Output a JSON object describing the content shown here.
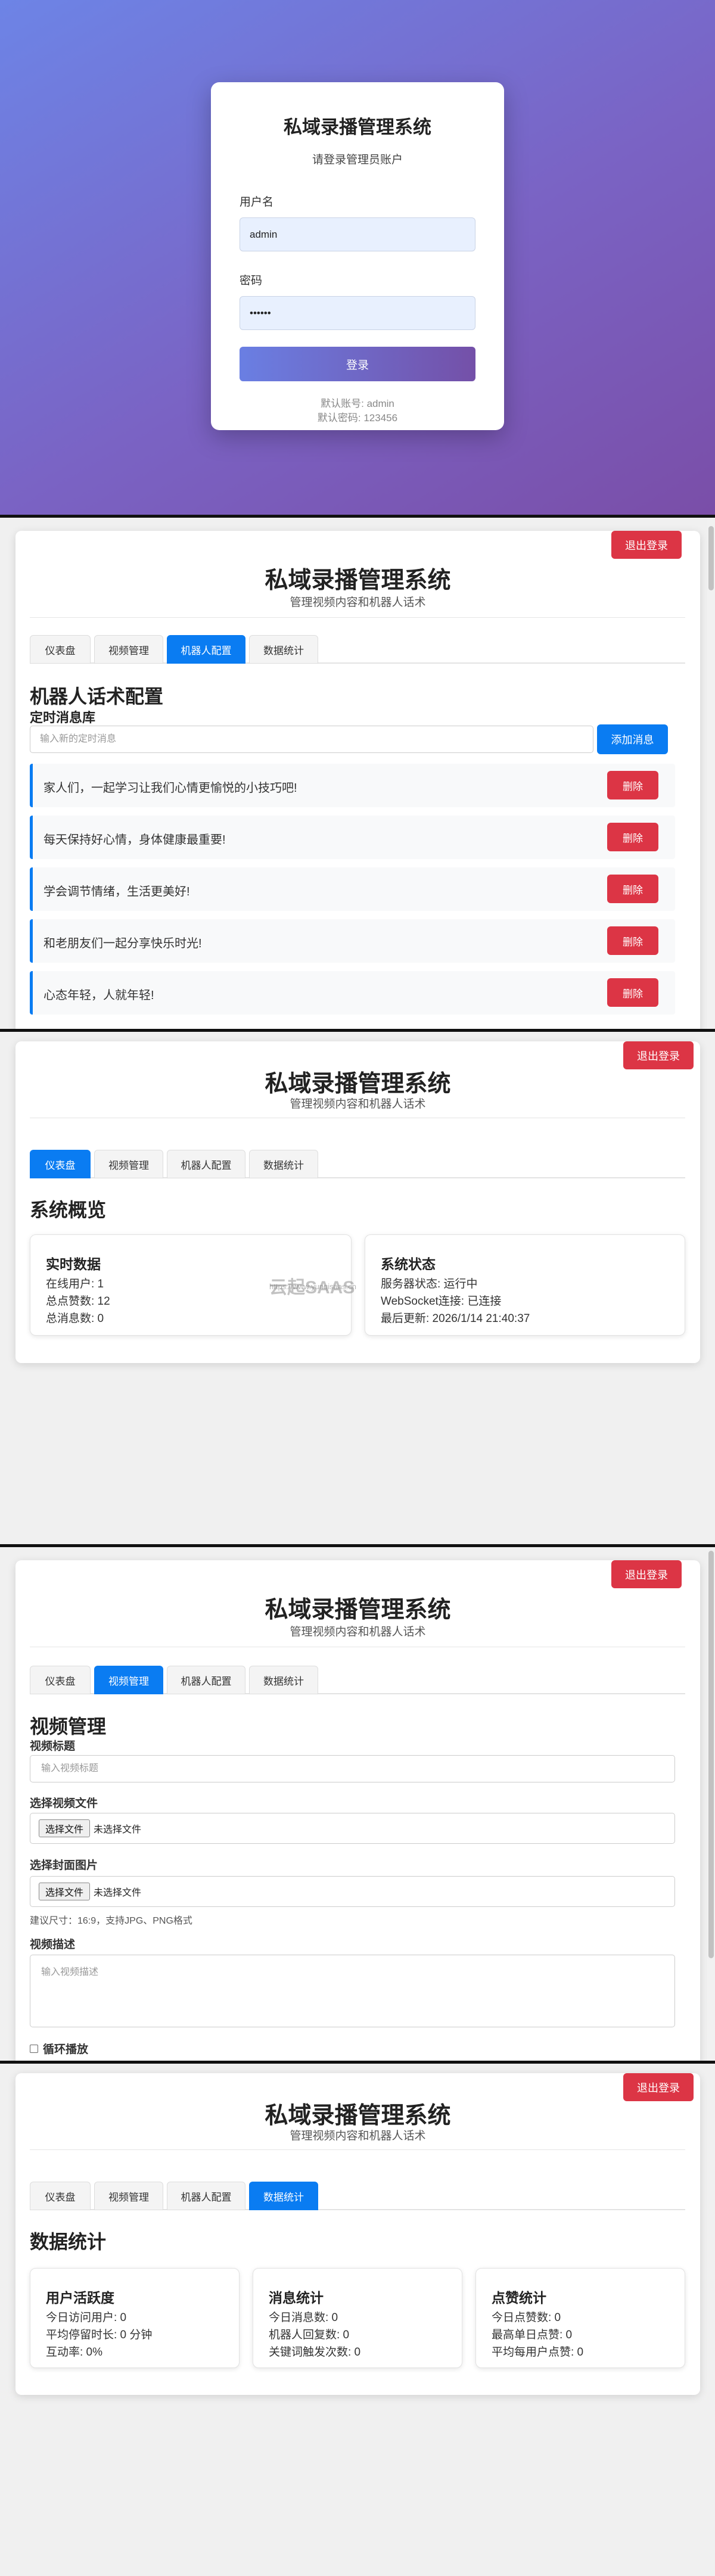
{
  "login": {
    "title": "私域录播管理系统",
    "subtitle": "请登录管理员账户",
    "username_label": "用户名",
    "username_value": "admin",
    "password_label": "密码",
    "password_value": "123456",
    "submit_label": "登录",
    "hint_account": "默认账号: admin",
    "hint_password": "默认密码: 123456"
  },
  "app": {
    "title": "私域录播管理系统",
    "subtitle": "管理视频内容和机器人话术",
    "logout_label": "退出登录",
    "tabs": [
      "仪表盘",
      "视频管理",
      "机器人配置",
      "数据统计"
    ]
  },
  "robot": {
    "heading": "机器人话术配置",
    "section": "定时消息库",
    "input_placeholder": "输入新的定时消息",
    "add_label": "添加消息",
    "delete_label": "删除",
    "messages": [
      "家人们，一起学习让我们心情更愉悦的小技巧吧!",
      "每天保持好心情，身体健康最重要!",
      "学会调节情绪，生活更美好!",
      "和老朋友们一起分享快乐时光!",
      "心态年轻，人就年轻!"
    ]
  },
  "dashboard": {
    "heading": "系统概览",
    "realtime": {
      "title": "实时数据",
      "lines": [
        "在线用户: 1",
        "总点赞数: 12",
        "总消息数: 0"
      ]
    },
    "status": {
      "title": "系统状态",
      "lines": [
        "服务器状态: 运行中",
        "WebSocket连接: 已连接",
        "最后更新: 2026/1/14 21:40:37"
      ]
    },
    "watermark": "云起SAAS",
    "watermark_url": "https://www.yunqisaas.cn"
  },
  "video": {
    "heading": "视频管理",
    "title_label": "视频标题",
    "title_placeholder": "输入视频标题",
    "file_label": "选择视频文件",
    "file_button": "选择文件",
    "file_none": "未选择文件",
    "cover_label": "选择封面图片",
    "cover_button": "选择文件",
    "cover_none": "未选择文件",
    "cover_hint": "建议尺寸：16:9，支持JPG、PNG格式",
    "desc_label": "视频描述",
    "desc_placeholder": "输入视频描述",
    "loop_label": "循环播放"
  },
  "stats": {
    "heading": "数据统计",
    "cards": [
      {
        "title": "用户活跃度",
        "lines": [
          "今日访问用户: 0",
          "平均停留时长: 0 分钟",
          "互动率: 0%"
        ]
      },
      {
        "title": "消息统计",
        "lines": [
          "今日消息数: 0",
          "机器人回复数: 0",
          "关键词触发次数: 0"
        ]
      },
      {
        "title": "点赞统计",
        "lines": [
          "今日点赞数: 0",
          "最高单日点赞: 0",
          "平均每用户点赞: 0"
        ]
      }
    ]
  }
}
